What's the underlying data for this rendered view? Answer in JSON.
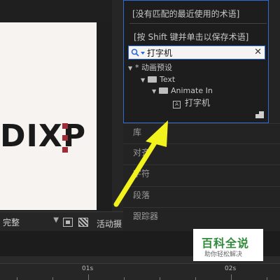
{
  "viewer": {
    "composition_text": "DIXP",
    "resolution": "完整",
    "active_camera": "活动摄"
  },
  "term_dropdown": {
    "no_match": "[没有匹配的最近使用的术语]",
    "shift_hint": "[按 Shift 键并单击以保存术语]"
  },
  "search": {
    "value": "打字机",
    "clear_glyph": "✕"
  },
  "preset_tree": [
    {
      "label": "* 动画预设",
      "expanded": true
    },
    {
      "label": "Text",
      "expanded": true
    },
    {
      "label": "Animate In",
      "expanded": true
    },
    {
      "label": "打字机",
      "icon": "preset-icon"
    }
  ],
  "panels": {
    "library": "库",
    "align": "对齐",
    "character": "字符",
    "paragraph": "段落",
    "tracker": "跟踪器"
  },
  "timeline": {
    "ticks": [
      "01s",
      "02s"
    ]
  },
  "watermark": {
    "title": "百科全说",
    "subtitle": "助你轻松解决"
  },
  "colors": {
    "accent_blue": "#2d6bd1",
    "arrow_yellow": "#f2f21c",
    "handle_red": "#a02a35",
    "watermark_green": "#2f8a3c"
  }
}
